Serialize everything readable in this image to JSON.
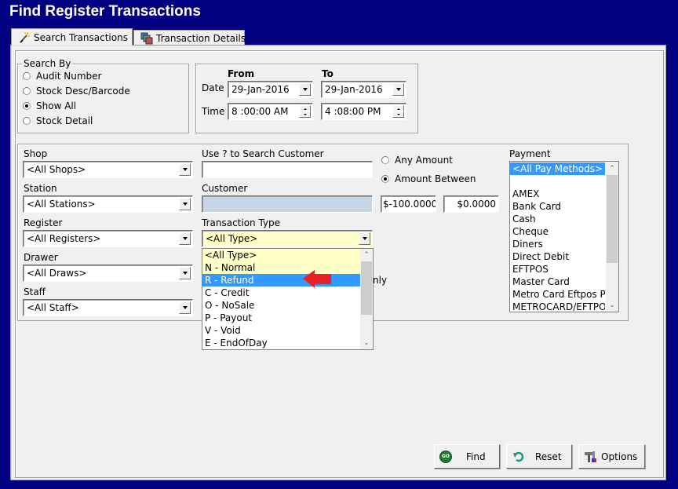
{
  "window": {
    "title": "Find Register Transactions"
  },
  "tabs": [
    {
      "label": "Search Transactions",
      "accel": "S",
      "icon": "magic-wand-icon",
      "active": true
    },
    {
      "label": "Transaction Details",
      "accel": "T",
      "icon": "stacked-windows-icon",
      "active": false
    }
  ],
  "search_by": {
    "legend": "Search By",
    "options": [
      {
        "label": "Audit Number",
        "selected": false
      },
      {
        "label": "Stock Desc/Barcode",
        "selected": false
      },
      {
        "label": "Show All",
        "selected": true
      },
      {
        "label": "Stock Detail",
        "selected": false
      }
    ]
  },
  "date_range": {
    "from_label": "From",
    "to_label": "To",
    "date_label": "Date",
    "time_label": "Time",
    "from_date": "29-Jan-2016",
    "to_date": "29-Jan-2016",
    "from_time": "8 :00:00 AM",
    "to_time": "4 :08:00 PM"
  },
  "filters": {
    "shop": {
      "label": "Shop",
      "value": "<All Shops>"
    },
    "station": {
      "label": "Station",
      "value": "<All Stations>"
    },
    "register": {
      "label": "Register",
      "value": "<All Registers>"
    },
    "drawer": {
      "label": "Drawer",
      "value": "<All Draws>"
    },
    "staff": {
      "label": "Staff",
      "value": "<All Staff>"
    },
    "customer_search": {
      "label": "Use ? to Search Customer",
      "value": ""
    },
    "customer": {
      "label": "Customer",
      "value": ""
    },
    "transaction_type": {
      "label": "Transaction Type",
      "value": "<All Type>",
      "options": [
        "<All Type>",
        "N - Normal",
        "R - Refund",
        "C - Credit",
        "O - NoSale",
        "P - Payout",
        "V - Void",
        "E - EndOfDay"
      ],
      "highlighted": "R - Refund"
    },
    "hidden_checkbox_fragment": "nly"
  },
  "amount": {
    "any_label": "Any Amount",
    "between_label": "Amount Between",
    "mode": "between",
    "min": "$-100.0000",
    "max": "$0.0000"
  },
  "payment": {
    "label": "Payment",
    "items": [
      "<All Pay Methods>",
      "",
      "AMEX",
      "Bank Card",
      "Cash",
      "Cheque",
      "Diners",
      "Direct Debit",
      "EFTPOS",
      "Master Card",
      "Metro Card Eftpos Pa",
      "METROCARD/EFTPO"
    ],
    "selected": "<All Pay Methods>"
  },
  "buttons": {
    "find": {
      "label": "Find",
      "icon": "go-icon"
    },
    "reset": {
      "label": "Reset",
      "icon": "undo-icon"
    },
    "options": {
      "label": "Options",
      "icon": "tools-icon"
    }
  },
  "annotation": {
    "arrow_color": "#e8202a",
    "points_to": "R - Refund"
  },
  "colors": {
    "title_bar": "#000080",
    "selection": "#3399ff",
    "highlight_field": "#ffffc8"
  }
}
